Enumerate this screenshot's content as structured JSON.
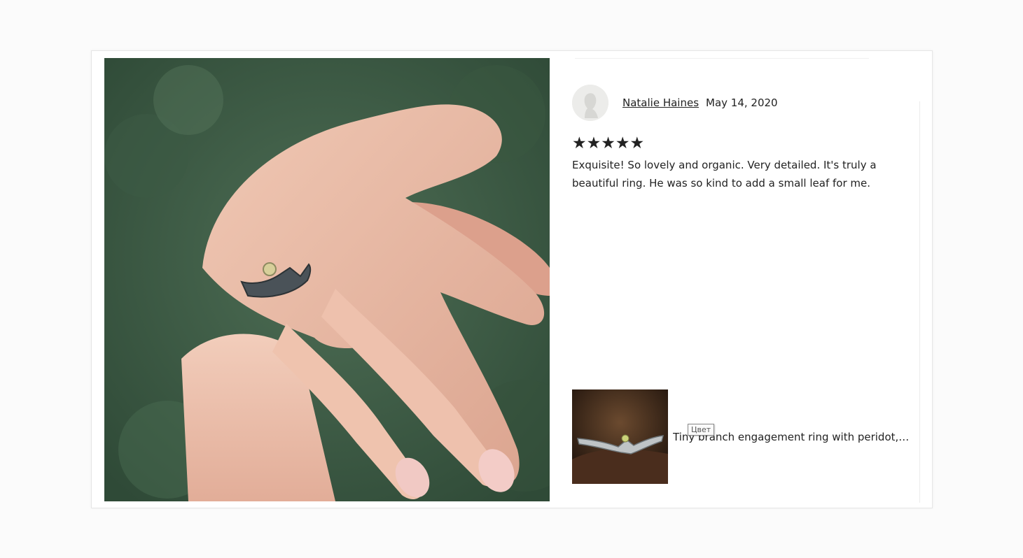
{
  "review": {
    "reviewer_name": "Natalie Haines",
    "date": "May 14, 2020",
    "stars_display": "★★★★★",
    "rating": 5,
    "text": "Exquisite! So lovely and organic. Very detailed. It's truly a beautiful ring. He was so kind to add a small leaf for me."
  },
  "product": {
    "title": "Tiny branch engagement ring with peridot, D..."
  },
  "tooltip": {
    "text": "Цвет"
  },
  "icons": {
    "avatar": "user-silhouette-icon",
    "star": "star-icon"
  },
  "colors": {
    "text": "#222222",
    "photo_background": "#3f5b46",
    "card_border": "#e6e6e6"
  }
}
